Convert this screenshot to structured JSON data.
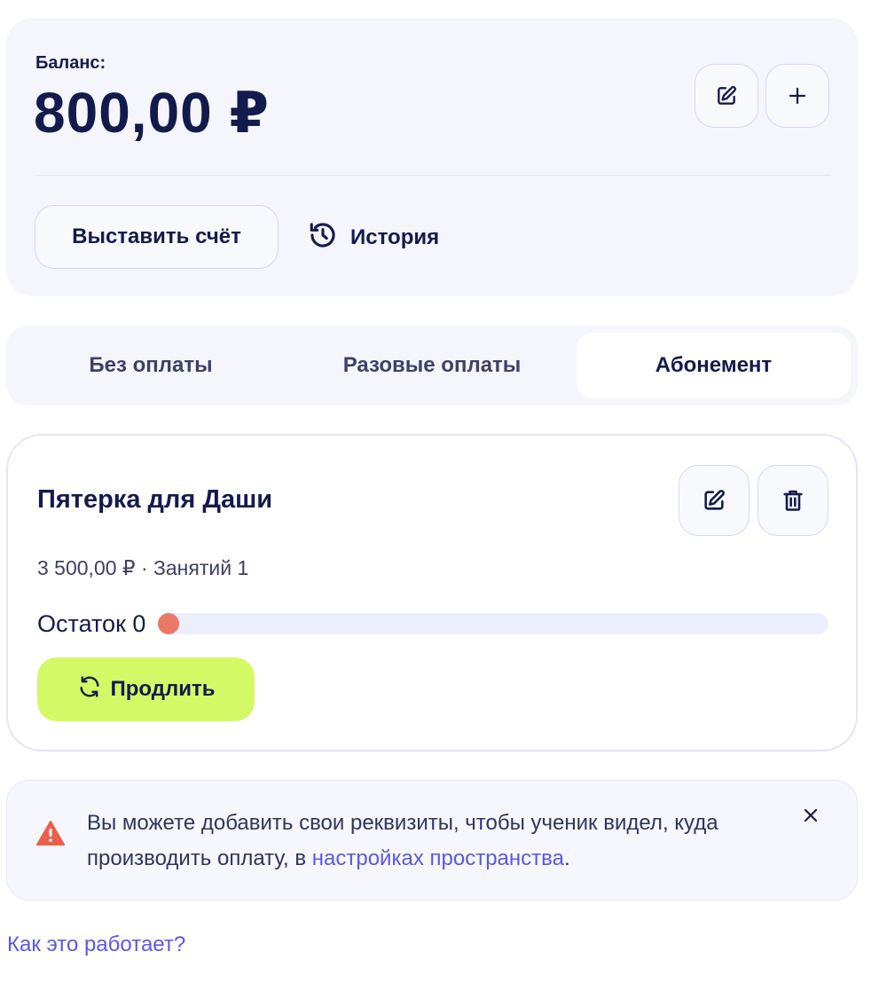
{
  "balance": {
    "label": "Баланс:",
    "value": "800,00 ₽",
    "edit_icon": "edit-icon",
    "add_icon": "plus-icon",
    "invoice_button": "Выставить счёт",
    "history_link": "История",
    "history_icon": "history-icon"
  },
  "tabs": [
    {
      "label": "Без оплаты",
      "active": false
    },
    {
      "label": "Разовые оплаты",
      "active": false
    },
    {
      "label": "Абонемент",
      "active": true
    }
  ],
  "subscription": {
    "title": "Пятерка для Даши",
    "meta": "3 500,00 ₽ · Занятий 1",
    "remaining_label": "Остаток 0",
    "remaining_fraction": 0,
    "renew_button": "Продлить",
    "edit_icon": "edit-icon",
    "delete_icon": "trash-icon",
    "renew_icon": "refresh-icon"
  },
  "notice": {
    "text_before": "Вы можете добавить свои реквизиты, чтобы ученик видел, куда производить оплату, в ",
    "link": "настройках пространства",
    "text_after": ".",
    "icon": "warning-icon",
    "close_icon": "close-icon"
  },
  "help_link": "Как это работает?",
  "colors": {
    "text": "#131b4d",
    "card_bg": "#f5f6fc",
    "accent_link": "#5a57e8",
    "renew_bg": "#d3f966",
    "warning": "#e8604c",
    "progress_dot": "#e97966"
  }
}
